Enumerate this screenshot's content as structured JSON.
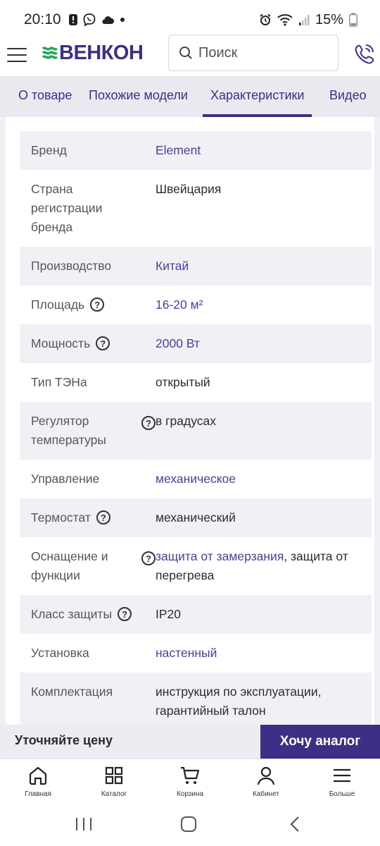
{
  "status_bar": {
    "time": "20:10",
    "battery": "15%",
    "icons": [
      "alert-icon",
      "viber-icon",
      "cloud-icon",
      "dot-icon",
      "alarm-icon",
      "wifi-icon",
      "signal-icon",
      "battery-icon"
    ]
  },
  "header": {
    "logo_text": "ВЕНКОН",
    "search_placeholder": "Поиск"
  },
  "tabs": [
    {
      "label": "О товаре",
      "active": false
    },
    {
      "label": "Похожие модели",
      "active": false
    },
    {
      "label": "Характеристики",
      "active": true
    },
    {
      "label": "Видео",
      "active": false
    }
  ],
  "specs": [
    {
      "label": "Бренд",
      "value_parts": [
        {
          "text": "Element",
          "link": true
        }
      ],
      "help": false
    },
    {
      "label": "Страна регистрации бренда",
      "value_parts": [
        {
          "text": "Швейцария",
          "link": false
        }
      ],
      "help": false
    },
    {
      "label": "Производство",
      "value_parts": [
        {
          "text": "Китай",
          "link": true
        }
      ],
      "help": false
    },
    {
      "label": "Площадь",
      "value_parts": [
        {
          "text": "16-20 м²",
          "link": true
        }
      ],
      "help": true
    },
    {
      "label": "Мощность",
      "value_parts": [
        {
          "text": "2000 Вт",
          "link": true
        }
      ],
      "help": true
    },
    {
      "label": "Тип ТЭНа",
      "value_parts": [
        {
          "text": "открытый",
          "link": false
        }
      ],
      "help": false
    },
    {
      "label": "Регулятор температуры",
      "value_parts": [
        {
          "text": "в градусах",
          "link": false
        }
      ],
      "help": true
    },
    {
      "label": "Управление",
      "value_parts": [
        {
          "text": "механическое",
          "link": true
        }
      ],
      "help": false
    },
    {
      "label": "Термостат",
      "value_parts": [
        {
          "text": "механический",
          "link": false
        }
      ],
      "help": true
    },
    {
      "label": "Оснащение и функции",
      "value_parts": [
        {
          "text": "защита от замерзания",
          "link": true
        },
        {
          "text": ", защита от перегрева",
          "link": false
        }
      ],
      "help": true
    },
    {
      "label": "Класс защиты",
      "value_parts": [
        {
          "text": "IP20",
          "link": false
        }
      ],
      "help": true
    },
    {
      "label": "Установка",
      "value_parts": [
        {
          "text": "настенный",
          "link": true
        }
      ],
      "help": false
    },
    {
      "label": "Комплектация",
      "value_parts": [
        {
          "text": "инструкция по эксплуатации, гарантийный талон",
          "link": false
        }
      ],
      "help": false
    }
  ],
  "price_bar": {
    "hint": "Уточняйте цену",
    "button": "Хочу аналог"
  },
  "bottom_nav": [
    {
      "label": "Главная",
      "icon": "home-icon"
    },
    {
      "label": "Каталог",
      "icon": "catalog-icon"
    },
    {
      "label": "Корзина",
      "icon": "cart-icon"
    },
    {
      "label": "Кабинет",
      "icon": "user-icon"
    },
    {
      "label": "Больше",
      "icon": "menu-icon"
    }
  ],
  "colors": {
    "brand": "#3c2f86",
    "link": "#4b3f9a",
    "logo_green": "#1fa85a",
    "row_shade": "#f1f1f5"
  }
}
